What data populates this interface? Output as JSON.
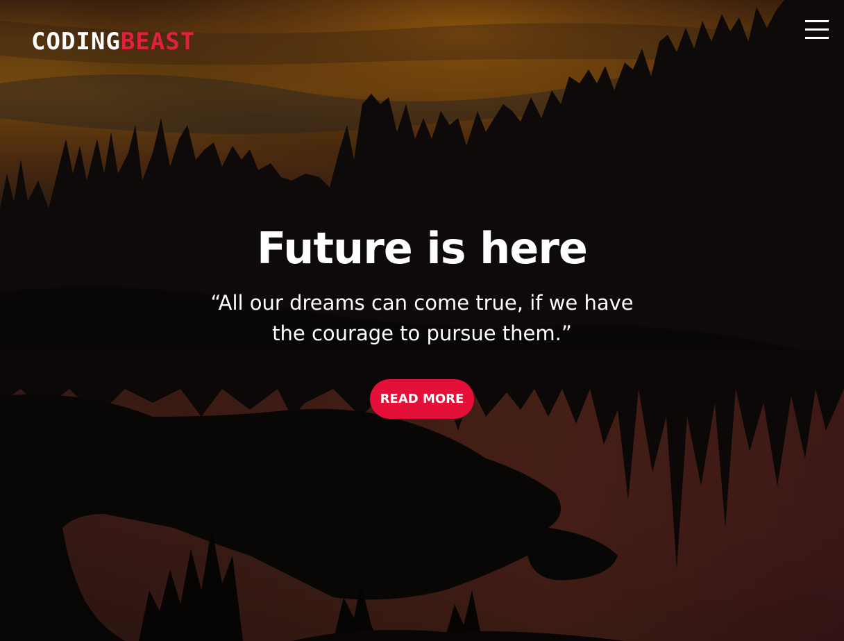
{
  "brand": {
    "part1": "CODING",
    "part2": "BEAST",
    "accent_color": "#e0203c"
  },
  "nav": {
    "menu_icon": "hamburger-menu-icon"
  },
  "hero": {
    "title": "Future is here",
    "quote": "“All our dreams can come true, if we have the courage to pursue them.”",
    "button_label": "READ MORE",
    "button_color": "#e5103a",
    "background": "sunset over forest lake"
  }
}
